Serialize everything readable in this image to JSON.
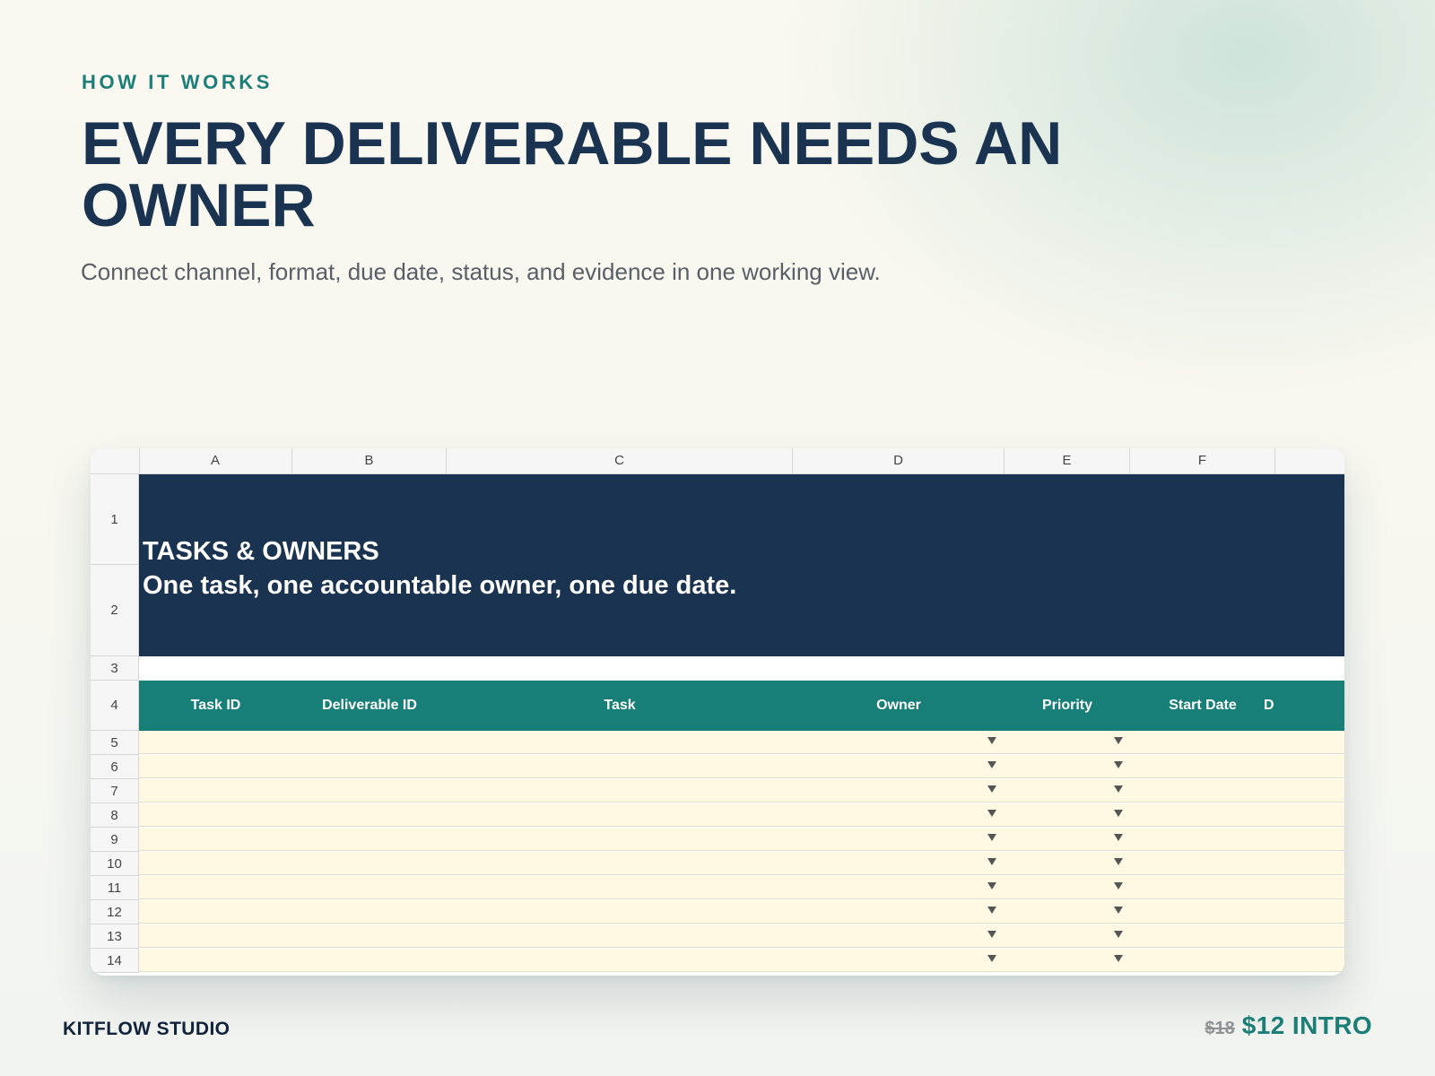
{
  "header": {
    "eyebrow": "HOW IT WORKS",
    "headline": "EVERY DELIVERABLE NEEDS AN OWNER",
    "subtitle": "Connect channel, format, due date, status, and evidence in one working view."
  },
  "sheet": {
    "columns": [
      "A",
      "B",
      "C",
      "D",
      "E",
      "F"
    ],
    "rows": [
      "1",
      "2",
      "3",
      "4",
      "5",
      "6",
      "7",
      "8",
      "9",
      "10",
      "11",
      "12",
      "13",
      "14"
    ],
    "banner_title": "TASKS & OWNERS",
    "banner_subtitle": "One task, one accountable owner, one due date.",
    "table_headers": [
      "Task ID",
      "Deliverable ID",
      "Task",
      "Owner",
      "Priority",
      "Start Date",
      "D"
    ]
  },
  "footer": {
    "brand": "KITFLOW STUDIO",
    "old_price": "$18",
    "new_price": "$12 INTRO"
  },
  "colors": {
    "navy": "#193350",
    "teal": "#177f78",
    "cell_fill": "#fff8e2"
  }
}
